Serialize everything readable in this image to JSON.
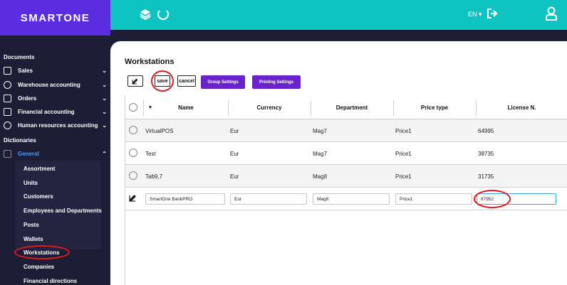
{
  "brand": {
    "name": "SMARTONE"
  },
  "topbar": {
    "language": "EN ▾"
  },
  "sidebar": {
    "section_documents": "Documents",
    "items": [
      {
        "label": "Sales",
        "icon": "grid-icon"
      },
      {
        "label": "Warehouse accounting",
        "icon": "cube-icon"
      },
      {
        "label": "Orders",
        "icon": "grid-icon"
      },
      {
        "label": "Financial accounting",
        "icon": "calculator-icon"
      },
      {
        "label": "Human resources accounting",
        "icon": "people-icon"
      }
    ],
    "section_dictionaries": "Dictionaries",
    "general": {
      "label": "General",
      "icon": "book-icon"
    },
    "sub_items": [
      "Assortment",
      "Units",
      "Customers",
      "Employees and Departments",
      "Posts",
      "Wallets",
      "Workstations",
      "Companies",
      "Financial directions"
    ]
  },
  "main": {
    "title": "Workstations",
    "toolbar": {
      "save": "save",
      "cancel": "cancel",
      "group_settings": "Group Settings",
      "printing_settings": "Printing Settings"
    },
    "columns": [
      "Name",
      "Currency",
      "Department",
      "Price type",
      "License N."
    ],
    "rows": [
      {
        "name": "VirtualPOS",
        "currency": "Eur",
        "department": "Mag7",
        "price_type": "Price1",
        "license": "64995"
      },
      {
        "name": "Test",
        "currency": "Eur",
        "department": "Mag7",
        "price_type": "Price1",
        "license": "38735"
      },
      {
        "name": "Tab9,7",
        "currency": "Eur",
        "department": "Mag8",
        "price_type": "Price1",
        "license": "31735"
      }
    ],
    "edit_row": {
      "name": "SmartOne BankPRO",
      "currency": "Eur",
      "department": "Mag8",
      "price_type": "Price1",
      "license": "67952"
    }
  },
  "colors": {
    "brand": "#5a2ee0",
    "topbar": "#0ec4c2",
    "sidebar": "#1d1d35",
    "accent": "#6a22cc",
    "highlight": "#e01a1a"
  }
}
